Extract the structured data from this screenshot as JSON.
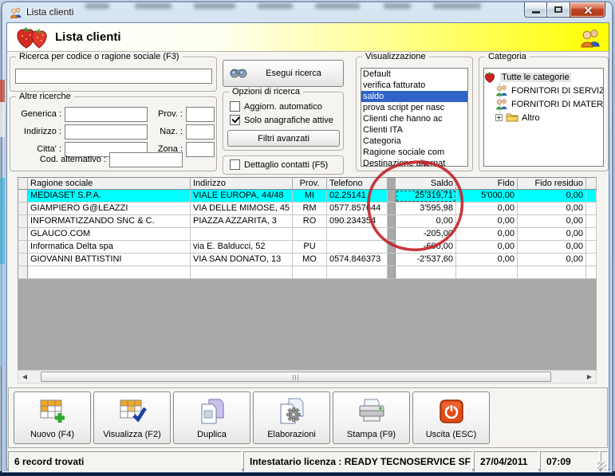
{
  "window": {
    "title": "Lista clienti",
    "icon": "users-icon"
  },
  "header": {
    "title": "Lista clienti",
    "left_icon": "strawberries-icon",
    "right_icon": "users-icon"
  },
  "search_group": {
    "label": "Ricerca per codice o ragione sociale (F3)",
    "value": ""
  },
  "altre_ricerche": {
    "label": "Altre ricerche",
    "left_fields": [
      {
        "label": "Generica :",
        "value": ""
      },
      {
        "label": "Indirizzo :",
        "value": ""
      },
      {
        "label": "Citta' :",
        "value": ""
      }
    ],
    "right_fields": [
      {
        "label": "Prov. :",
        "value": ""
      },
      {
        "label": "Naz. :",
        "value": ""
      },
      {
        "label": "Zona :",
        "value": ""
      }
    ],
    "alt_field": {
      "label": "Cod. alternativo :",
      "value": ""
    }
  },
  "ricerca_actions": {
    "esegui_label": "Esegui ricerca",
    "esegui_icon": "binoculars-icon",
    "opzioni_label": "Opzioni di ricerca",
    "checkboxes": [
      {
        "label": "Aggiorn. automatico",
        "checked": false
      },
      {
        "label": "Solo anagrafiche attive",
        "checked": true
      }
    ],
    "filtri_label": "Filtri avanzati",
    "dettaglio_checkbox": {
      "label": "Dettaglio contatti (F5)",
      "checked": false
    }
  },
  "visualizzazione": {
    "label": "Visualizzazione",
    "items": [
      "Default",
      "verifica fatturato",
      "saldo",
      "prova script per nasc",
      "Clienti che hanno ac",
      "Clienti ITA",
      "Categoria",
      "Ragione sociale com",
      "Destinazione alternat"
    ],
    "selected_index": 2
  },
  "categoria": {
    "label": "Categoria",
    "items": [
      {
        "label": "Tutte le categorie",
        "icon": "strawberry-icon",
        "level": 0,
        "selected": true,
        "expandable": false
      },
      {
        "label": "FORNITORI DI SERVIZI",
        "icon": "group-users-icon",
        "level": 1,
        "selected": false,
        "expandable": false
      },
      {
        "label": "FORNITORI DI MATERIALE",
        "icon": "group-users-icon",
        "level": 1,
        "selected": false,
        "expandable": false
      },
      {
        "label": "Altro",
        "icon": "folder-icon",
        "level": 1,
        "selected": false,
        "expandable": true
      }
    ]
  },
  "table": {
    "columns": [
      "",
      "Ragione sociale",
      "Indirizzo",
      "Prov.",
      "Telefono",
      "",
      "Saldo",
      "Fido",
      "Fido residuo",
      ""
    ],
    "rows": [
      {
        "ragione_sociale": "MEDIASET S.P.A.",
        "indirizzo": "VIALE EUROPA, 44/48",
        "prov": "MI",
        "telefono": "02.25141",
        "saldo": "25'319,71",
        "fido": "5'000,00",
        "fido_residuo": "0,00",
        "selected": true
      },
      {
        "ragione_sociale": "GIAMPIERO G@LEAZZI",
        "indirizzo": "VIA DELLE MIMOSE, 45",
        "prov": "RM",
        "telefono": "0577.857644",
        "saldo": "3'595,98",
        "fido": "0,00",
        "fido_residuo": "0,00",
        "selected": false
      },
      {
        "ragione_sociale": "INFORMATIZZANDO SNC & C.",
        "indirizzo": "PIAZZA AZZARITA, 3",
        "prov": "RO",
        "telefono": "090.234354",
        "saldo": "0,00",
        "fido": "0,00",
        "fido_residuo": "0,00",
        "selected": false
      },
      {
        "ragione_sociale": "GLAUCO.COM",
        "indirizzo": "",
        "prov": "",
        "telefono": "",
        "saldo": "-205,00",
        "fido": "0,00",
        "fido_residuo": "0,00",
        "selected": false
      },
      {
        "ragione_sociale": "Informatica Delta spa",
        "indirizzo": "via E. Balducci, 52",
        "prov": "PU",
        "telefono": "",
        "saldo": "-600,00",
        "fido": "0,00",
        "fido_residuo": "0,00",
        "selected": false
      },
      {
        "ragione_sociale": "GIOVANNI BATTISTINI",
        "indirizzo": "VIA SAN DONATO, 13",
        "prov": "MO",
        "telefono": "0574.846373",
        "saldo": "-2'537,60",
        "fido": "0,00",
        "fido_residuo": "0,00",
        "selected": false
      }
    ],
    "focused_cell": {
      "row": 0,
      "column": "saldo"
    }
  },
  "annotation": {
    "shape": "hand-drawn ellipse",
    "color": "#c2232a",
    "target": "Saldo column values"
  },
  "toolbar": {
    "buttons": [
      {
        "label": "Nuovo (F4)",
        "icon": "table-add-icon"
      },
      {
        "label": "Visualizza (F2)",
        "icon": "table-check-icon"
      },
      {
        "label": "Duplica",
        "icon": "copy-icon"
      },
      {
        "label": "Elaborazioni",
        "icon": "process-icon"
      },
      {
        "label": "Stampa (F9)",
        "icon": "printer-icon"
      },
      {
        "label": "Uscita (ESC)",
        "icon": "power-icon"
      }
    ]
  },
  "statusbar": {
    "records": "6 record trovati",
    "license": "Intestatario licenza : READY TECNOSERVICE SF",
    "date": "27/04/2011",
    "time": "07:09"
  }
}
